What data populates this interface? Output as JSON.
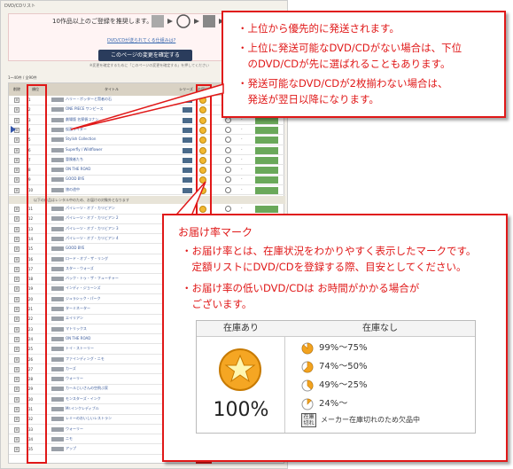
{
  "page": {
    "title": "DVD/CDリスト",
    "count_text": "1〜40件 / 全90件"
  },
  "header": {
    "recommend": "10作品以上のご登録を推奨します。",
    "dvd_link": "DVD/CDが送られてくる仕組みは?",
    "confirm_button": "このページの変更を確定する",
    "sub_note": "※変更を確定するために「このページの変更を確定する」を押してください"
  },
  "table": {
    "columns": [
      "削除",
      "順位",
      "タイトル",
      "シリーズ",
      "お届け率",
      "在庫",
      "",
      "操作"
    ],
    "section_label": "以下の作品はレンタル中のため、お届けの対象外となります",
    "rows": [
      {
        "num": "1",
        "title": "ハリー・ポッターと賢者の石"
      },
      {
        "num": "2",
        "title": "ONE PIECE ワンピース"
      },
      {
        "num": "3",
        "title": "劇場版 名探偵コナン"
      },
      {
        "num": "4",
        "title": "仮面ライダー"
      },
      {
        "num": "5",
        "title": "Stylish Collection"
      },
      {
        "num": "6",
        "title": "Superfly / Wildflower"
      },
      {
        "num": "7",
        "title": "冒険者たち"
      },
      {
        "num": "8",
        "title": "ON THE ROAD"
      },
      {
        "num": "9",
        "title": "GOOD BYE"
      },
      {
        "num": "10",
        "title": "旅の途中"
      },
      {
        "num": "11",
        "title": "パイレーツ・オブ・カリビアン"
      },
      {
        "num": "12",
        "title": "パイレーツ・オブ・カリビアン 2"
      },
      {
        "num": "13",
        "title": "パイレーツ・オブ・カリビアン 3"
      },
      {
        "num": "14",
        "title": "パイレーツ・オブ・カリビアン 4"
      },
      {
        "num": "15",
        "title": "GOOD BYE"
      },
      {
        "num": "16",
        "title": "ロード・オブ・ザ・リング"
      },
      {
        "num": "17",
        "title": "スター・ウォーズ"
      },
      {
        "num": "18",
        "title": "バック・トゥ・ザ・フューチャー"
      },
      {
        "num": "19",
        "title": "インディ・ジョーンズ"
      },
      {
        "num": "20",
        "title": "ジュラシック・パーク"
      },
      {
        "num": "21",
        "title": "ターミネーター"
      },
      {
        "num": "22",
        "title": "エイリアン"
      },
      {
        "num": "23",
        "title": "マトリックス"
      },
      {
        "num": "24",
        "title": "ON THE ROAD"
      },
      {
        "num": "25",
        "title": "トイ・ストーリー"
      },
      {
        "num": "26",
        "title": "ファインディング・ニモ"
      },
      {
        "num": "27",
        "title": "カーズ"
      },
      {
        "num": "28",
        "title": "ウォーリー"
      },
      {
        "num": "29",
        "title": "カールじいさんの空飛ぶ家"
      },
      {
        "num": "30",
        "title": "モンスターズ・インク"
      },
      {
        "num": "31",
        "title": "Mr.インクレディブル"
      },
      {
        "num": "32",
        "title": "レミーのおいしいレストラン"
      },
      {
        "num": "33",
        "title": "ウォーリー"
      },
      {
        "num": "34",
        "title": "ニモ"
      },
      {
        "num": "35",
        "title": "アップ"
      }
    ]
  },
  "callout1": {
    "lines": [
      "・上位から優先的に発送されます。",
      "・上位に発送可能なDVD/CDがない場合は、下位",
      "　のDVD/CDが先に選ばれることもあります。",
      "・発送可能なDVD/CDが2枚揃わない場合は、",
      "　発送が翌日以降になります。"
    ]
  },
  "callout2": {
    "title": "お届け率マーク",
    "lines": [
      "・お届け率とは、在庫状況をわかりやすく表示したマークです。",
      "　定額リストにDVD/CDを登録する際、目安としてください。",
      "・お届け率の低いDVD/CDは お時間がかかる場合が",
      "　ございます。"
    ]
  },
  "legend": {
    "in_stock_header": "在庫あり",
    "no_stock_header": "在庫なし",
    "in_stock_value": "100%",
    "rates": [
      {
        "label": "99%〜75%",
        "fill": 0.87
      },
      {
        "label": "74%〜50%",
        "fill": 0.62
      },
      {
        "label": "49%〜25%",
        "fill": 0.37
      },
      {
        "label": "24%〜",
        "fill": 0.12
      }
    ],
    "out_of_stock_icon": "在庫切れ",
    "out_of_stock_text": "メーカー在庫切れのため欠品中"
  },
  "colors": {
    "accent": "#e01818",
    "dot": "#f2b830",
    "header": "#2a3c5c"
  }
}
